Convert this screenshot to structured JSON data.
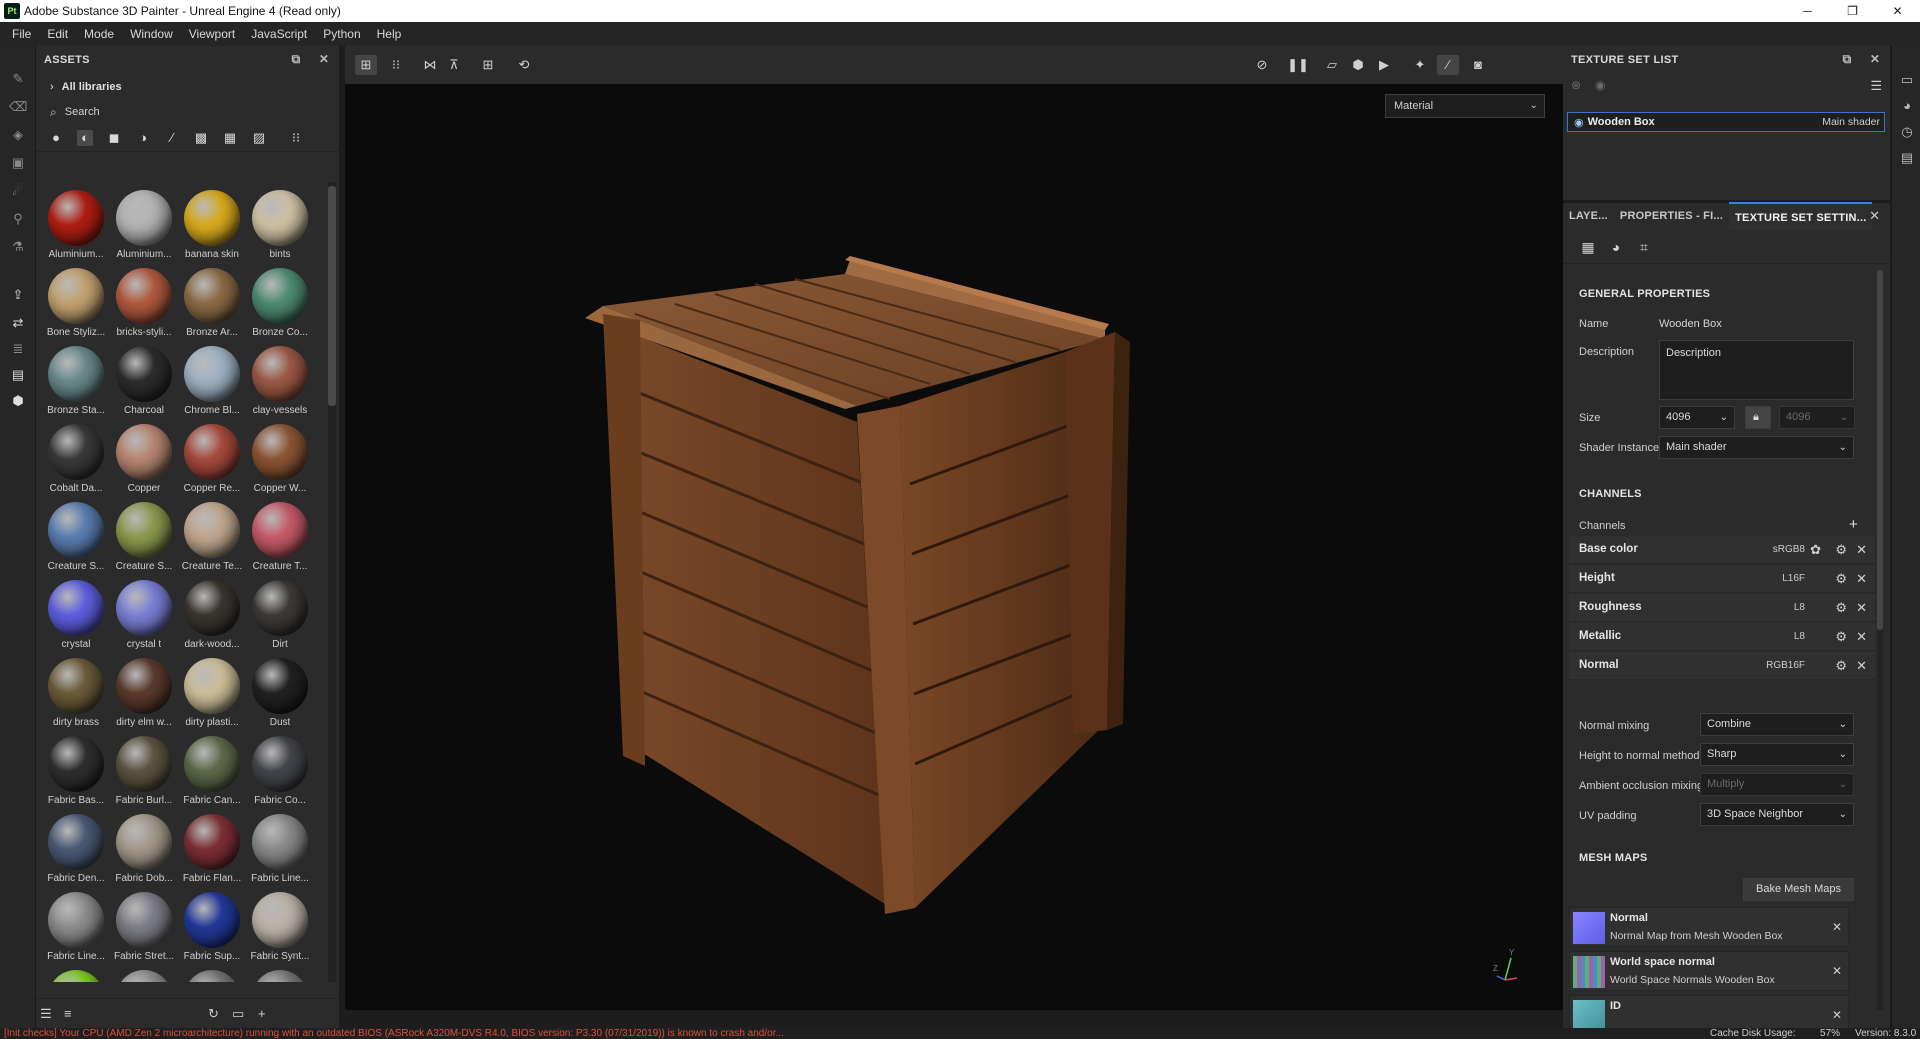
{
  "window": {
    "title": "Adobe Substance 3D Painter - Unreal Engine 4 (Read only)",
    "logo": "Pt",
    "min": "─",
    "max": "❐",
    "close": "✕"
  },
  "menu": [
    "File",
    "Edit",
    "Mode",
    "Window",
    "Viewport",
    "JavaScript",
    "Python",
    "Help"
  ],
  "assets": {
    "title": "ASSETS",
    "library": "All libraries",
    "search_placeholder": "Search",
    "materials": [
      {
        "name": "Aluminium...",
        "color": "#b01e14"
      },
      {
        "name": "Aluminium...",
        "color": "#b4b4b4"
      },
      {
        "name": "banana skin",
        "color": "#d9ab1c"
      },
      {
        "name": "bints",
        "color": "#cfc2a6"
      },
      {
        "name": "Bone Styliz...",
        "color": "#c4a271"
      },
      {
        "name": "bricks-styli...",
        "color": "#b25a3f"
      },
      {
        "name": "Bronze Ar...",
        "color": "#8d6b45"
      },
      {
        "name": "Bronze Co...",
        "color": "#4f8c74"
      },
      {
        "name": "Bronze Sta...",
        "color": "#6a8a8c"
      },
      {
        "name": "Charcoal",
        "color": "#2d2d2d"
      },
      {
        "name": "Chrome Bl...",
        "color": "#9fb3c4"
      },
      {
        "name": "clay-vessels",
        "color": "#9c5a45"
      },
      {
        "name": "Cobalt Da...",
        "color": "#3a3a3a"
      },
      {
        "name": "Copper",
        "color": "#b88671"
      },
      {
        "name": "Copper Re...",
        "color": "#a84a3d"
      },
      {
        "name": "Copper W...",
        "color": "#8d5533"
      },
      {
        "name": "Creature S...",
        "color": "#5a7eb1"
      },
      {
        "name": "Creature S...",
        "color": "#8c9a4e"
      },
      {
        "name": "Creature Te...",
        "color": "#c2a78f"
      },
      {
        "name": "Creature T...",
        "color": "#c85a68"
      },
      {
        "name": "crystal",
        "color": "#5f5fe0"
      },
      {
        "name": "crystal t",
        "color": "#7c80d8"
      },
      {
        "name": "dark-wood...",
        "color": "#3a3530"
      },
      {
        "name": "Dirt",
        "color": "#3d3a37"
      },
      {
        "name": "dirty brass",
        "color": "#6b5c3a"
      },
      {
        "name": "dirty elm w...",
        "color": "#5c3a2c"
      },
      {
        "name": "dirty plasti...",
        "color": "#cdbf99"
      },
      {
        "name": "Dust",
        "color": "#222222"
      },
      {
        "name": "Fabric Bas...",
        "color": "#2f2f2f"
      },
      {
        "name": "Fabric Burl...",
        "color": "#5b5442"
      },
      {
        "name": "Fabric Can...",
        "color": "#5e6a4a"
      },
      {
        "name": "Fabric Co...",
        "color": "#44464c"
      },
      {
        "name": "Fabric Den...",
        "color": "#4b5a74"
      },
      {
        "name": "Fabric Dob...",
        "color": "#a59a8b"
      },
      {
        "name": "Fabric Flan...",
        "color": "#7d2f35"
      },
      {
        "name": "Fabric Line...",
        "color": "#8a8a8a"
      },
      {
        "name": "Fabric Line...",
        "color": "#8d8d8d"
      },
      {
        "name": "Fabric Stret...",
        "color": "#7e7f86"
      },
      {
        "name": "Fabric Sup...",
        "color": "#23399a"
      },
      {
        "name": "Fabric Synt...",
        "color": "#bab3a8"
      },
      {
        "name": "",
        "color": "#7fcc29"
      },
      {
        "name": "",
        "color": "#8f8f8f"
      },
      {
        "name": "",
        "color": "#777777"
      },
      {
        "name": "",
        "color": "#7a7a7a"
      }
    ]
  },
  "viewport": {
    "display_mode": "Material",
    "axis_y": "Y",
    "axis_z": "Z"
  },
  "texture_set_list": {
    "title": "TEXTURE SET LIST",
    "set_name": "Wooden Box",
    "shader": "Main shader"
  },
  "tabs": {
    "layers": "LAYE...",
    "properties": "PROPERTIES - FI...",
    "tss": "TEXTURE SET SETTIN..."
  },
  "tss": {
    "general_title": "GENERAL PROPERTIES",
    "name_label": "Name",
    "name_value": "Wooden Box",
    "description_label": "Description",
    "description_value": "Description",
    "size_label": "Size",
    "size_value": "4096",
    "size_value_locked": "4096",
    "shader_label": "Shader Instance",
    "shader_value": "Main shader",
    "channels_title": "CHANNELS",
    "channels_label": "Channels",
    "channels": [
      {
        "name": "Base color",
        "format": "sRGB8"
      },
      {
        "name": "Height",
        "format": "L16F"
      },
      {
        "name": "Roughness",
        "format": "L8"
      },
      {
        "name": "Metallic",
        "format": "L8"
      },
      {
        "name": "Normal",
        "format": "RGB16F"
      }
    ],
    "normal_mixing_label": "Normal mixing",
    "normal_mixing_value": "Combine",
    "h2n_label": "Height to normal method",
    "h2n_value": "Sharp",
    "ao_label": "Ambient occlusion mixing",
    "ao_value": "Multiply",
    "uv_label": "UV padding",
    "uv_value": "3D Space Neighbor",
    "mesh_maps_title": "MESH MAPS",
    "bake_button": "Bake Mesh Maps",
    "mesh_maps": [
      {
        "title": "Normal",
        "sub": "Normal Map from Mesh Wooden Box",
        "color": "#7a7af0"
      },
      {
        "title": "World space normal",
        "sub": "World Space Normals Wooden Box",
        "color": "#5fae74"
      },
      {
        "title": "ID",
        "sub": "",
        "color": "#5fa7b0"
      }
    ]
  },
  "status": {
    "message": "[Init checks] Your CPU (AMD Zen 2 microarchitecture) running with an outdated BIOS (ASRock A320M-DVS R4.0, BIOS version: P3.30 (07/31/2019)) is known to crash and/or...",
    "cache": "Cache Disk Usage:",
    "cache_pct": "57%",
    "version": "Version: 8.3.0"
  }
}
